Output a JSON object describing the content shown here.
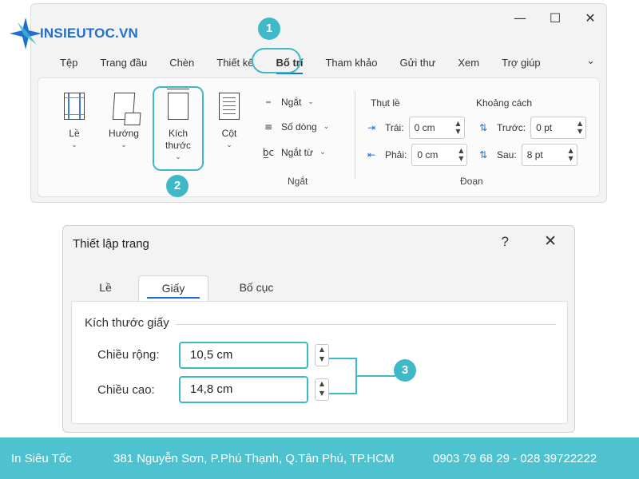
{
  "brand": {
    "name": "INSIEUTOC.VN"
  },
  "window": {
    "controls": {
      "minimize": "—",
      "maximize": "☐",
      "close": "✕"
    }
  },
  "ribbon": {
    "tabs": [
      "Tệp",
      "Trang đầu",
      "Chèn",
      "Thiết kế",
      "Bố trí",
      "Tham khảo",
      "Gửi thư",
      "Xem",
      "Trợ giúp"
    ],
    "active_tab": "Bố trí",
    "collapse_icon": "chevron-down-icon",
    "page_setup": {
      "margins": "Lề",
      "orientation": "Hướng",
      "size_line1": "Kích",
      "size_line2": "thước",
      "columns": "Cột"
    },
    "breaks_group": {
      "breaks": "Ngắt",
      "line_numbers": "Số dòng",
      "hyphenation": "Ngắt từ",
      "label": "Ngắt"
    },
    "paragraph": {
      "indent_head": "Thụt lề",
      "spacing_head": "Khoảng cách",
      "left_label": "Trái:",
      "left_value": "0 cm",
      "right_label": "Phải:",
      "right_value": "0 cm",
      "before_label": "Trước:",
      "before_value": "0 pt",
      "after_label": "Sau:",
      "after_value": "8 pt",
      "label": "Đoạn"
    }
  },
  "badges": {
    "one": "1",
    "two": "2",
    "three": "3"
  },
  "dialog": {
    "title": "Thiết lập trang",
    "help": "?",
    "close": "✕",
    "tabs": [
      "Lề",
      "Giấy",
      "Bố cục"
    ],
    "active_tab": "Giấy",
    "section": "Kích thước giấy",
    "width_label": "Chiều rộng:",
    "width_value": "10,5 cm",
    "height_label": "Chiều cao:",
    "height_value": "14,8 cm"
  },
  "footer": {
    "company": "In Siêu Tốc",
    "address": "381 Nguyễn Sơn, P.Phú Thạnh, Q.Tân Phú, TP.HCM",
    "phones": "0903 79 68 29 - 028 39722222"
  },
  "colors": {
    "accent": "#3fb8c8",
    "brand": "#1f6fd1",
    "footer_bg": "#4ec3cf"
  }
}
